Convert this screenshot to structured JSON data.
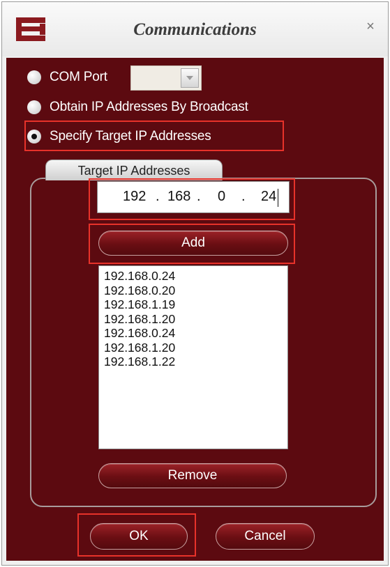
{
  "window": {
    "title": "Communications",
    "close_glyph": "×",
    "icons": {
      "logo": "app-logo-icon",
      "close": "close-icon"
    }
  },
  "options": {
    "com_port": {
      "label": "COM Port",
      "selected": false,
      "select_value": ""
    },
    "broadcast": {
      "label": "Obtain IP Addresses By Broadcast",
      "selected": false
    },
    "specify": {
      "label": "Specify Target IP Addresses",
      "selected": true
    }
  },
  "target_group": {
    "tab_label": "Target IP Addresses",
    "ip_input": {
      "octets": [
        "192",
        "168",
        "0",
        "24"
      ],
      "separator": "."
    },
    "add_label": "Add",
    "list_items": [
      "192.168.0.24",
      "192.168.0.20",
      "192.168.1.19",
      "192.168.1.20",
      "192.168.0.24",
      "192.168.1.20",
      "192.168.1.22"
    ],
    "remove_label": "Remove"
  },
  "buttons": {
    "ok": "OK",
    "cancel": "Cancel"
  },
  "colors": {
    "panel_bg": "#5c0a10",
    "button_gradient_top": "#9b2227",
    "highlight": "#e8322a",
    "logo": "#8b1a1f"
  }
}
